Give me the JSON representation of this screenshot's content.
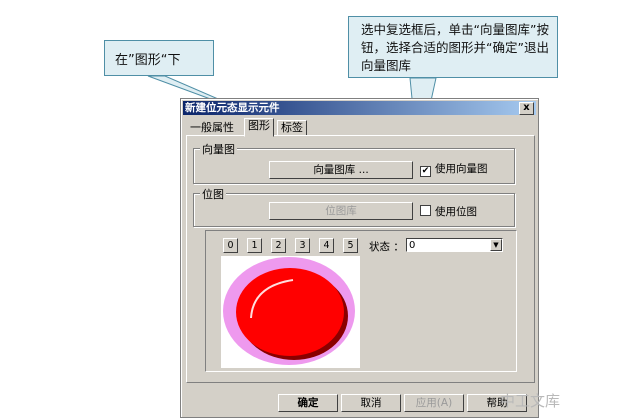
{
  "callouts": {
    "left": "在”图形“下",
    "right": "选中复选框后，单击“向量图库”按钮，选择合适的图形并“确定”退出向量图库"
  },
  "dialog": {
    "title": "新建位元态显示元件",
    "close_label": "x",
    "tabs": [
      "一般属性",
      "图形",
      "标签"
    ],
    "vector_group": {
      "title": "向量图",
      "button": "向量图库 ...",
      "checkbox_label": "使用向量图",
      "checked": true
    },
    "bitmap_group": {
      "title": "位图",
      "button": "位图库",
      "checkbox_label": "使用位图",
      "checked": false
    },
    "state_buttons": [
      "0",
      "1",
      "2",
      "3",
      "4",
      "5"
    ],
    "state_label": "状态 ：",
    "state_value": "0",
    "buttons": {
      "ok": "确定",
      "cancel": "取消",
      "apply": "应用(A)",
      "help": "帮助"
    }
  },
  "colors": {
    "lamp_red": "#ff0000",
    "lamp_ring": "#ee99ee",
    "titlebar": "#0a246a",
    "callout_bg": "#dfeef3"
  },
  "watermark": "中工文库"
}
